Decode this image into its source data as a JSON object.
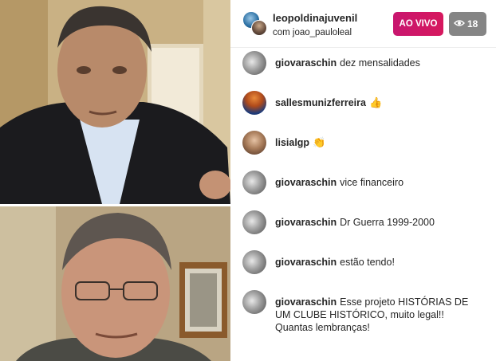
{
  "header": {
    "host_username": "leopoldinajuvenil",
    "guest_line": "com joao_pauloleal",
    "live_label": "AO VIVO",
    "viewer_count": "18"
  },
  "comments": [
    {
      "user": "giovaraschin",
      "text": "dez mensalidades",
      "avatar": "bw"
    },
    {
      "user": "sallesmunizferreira",
      "text": "👍",
      "avatar": "sport"
    },
    {
      "user": "lisialgp",
      "text": "👏",
      "avatar": "woman"
    },
    {
      "user": "giovaraschin",
      "text": "vice financeiro",
      "avatar": "bw"
    },
    {
      "user": "giovaraschin",
      "text": "Dr Guerra 1999-2000",
      "avatar": "bw"
    },
    {
      "user": "giovaraschin",
      "text": "estão tendo!",
      "avatar": "bw"
    },
    {
      "user": "giovaraschin",
      "text": "Esse projeto HISTÓRIAS DE UM CLUBE HISTÓRICO, muito legal!! Quantas lembranças!",
      "avatar": "bw"
    }
  ],
  "icons": {
    "viewer": "eye-icon"
  },
  "colors": {
    "live_badge": "#d1165f",
    "viewer_badge": "#858585"
  }
}
